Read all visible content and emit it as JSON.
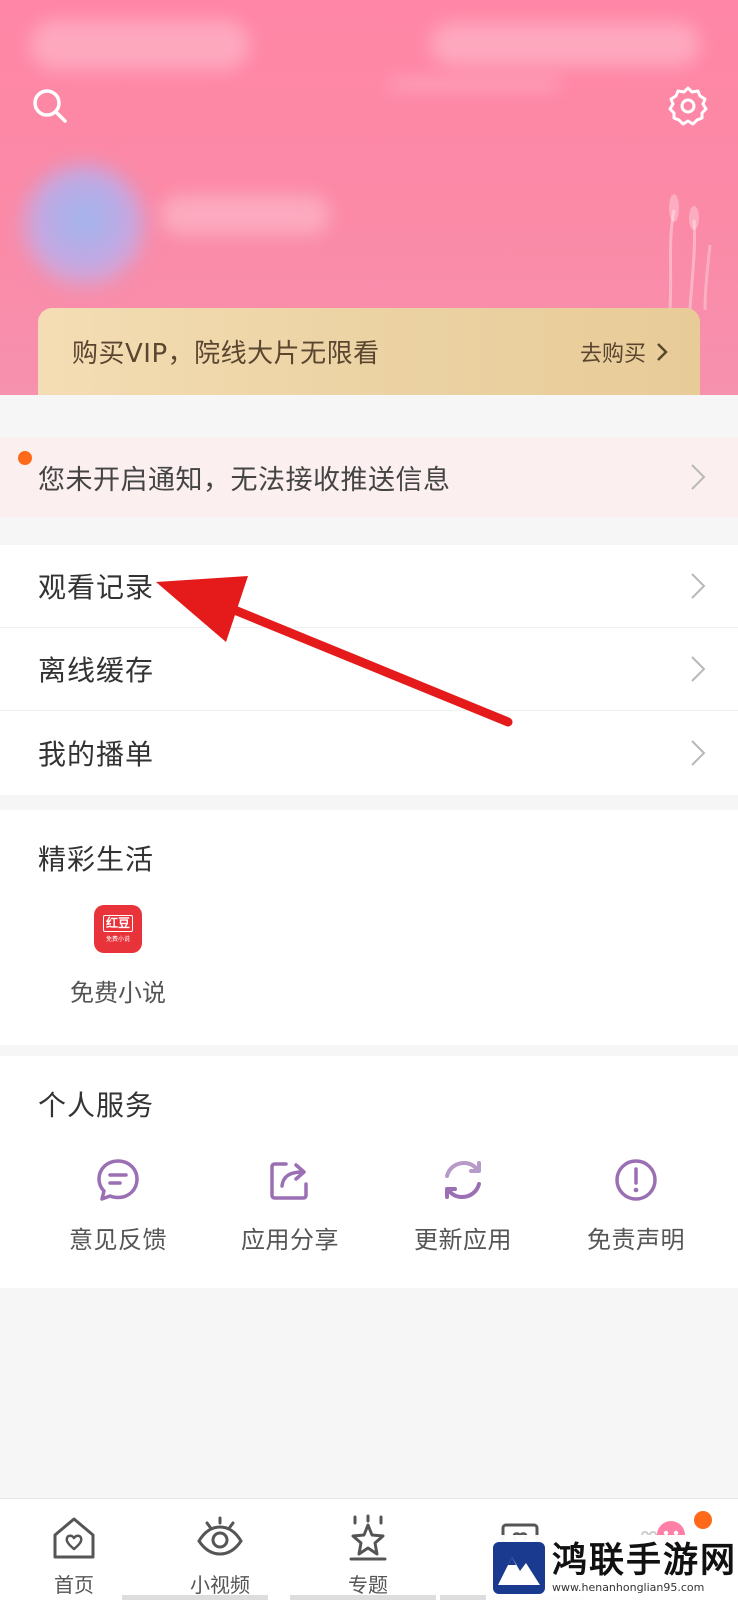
{
  "vip": {
    "text": "购买VIP，院线大片无限看",
    "buy_label": "去购买"
  },
  "notice": {
    "text": "您未开启通知，无法接收推送信息"
  },
  "menu": [
    {
      "label": "观看记录"
    },
    {
      "label": "离线缓存"
    },
    {
      "label": "我的播单"
    }
  ],
  "life": {
    "title": "精彩生活",
    "apps": [
      {
        "label": "免费小说",
        "icon": "hongdou-novel-app-icon",
        "icon_text": "红豆",
        "icon_subtext": "免费小说"
      }
    ]
  },
  "service": {
    "title": "个人服务",
    "items": [
      {
        "label": "意见反馈",
        "icon": "feedback-icon"
      },
      {
        "label": "应用分享",
        "icon": "share-icon"
      },
      {
        "label": "更新应用",
        "icon": "update-icon"
      },
      {
        "label": "免责声明",
        "icon": "disclaimer-icon"
      }
    ]
  },
  "bottom_nav": [
    {
      "label": "首页",
      "icon": "home-icon"
    },
    {
      "label": "小视频",
      "icon": "eye-icon"
    },
    {
      "label": "专题",
      "icon": "star-icon"
    },
    {
      "label": "",
      "icon": "tv-icon"
    },
    {
      "label": "",
      "icon": "mine-icon"
    }
  ],
  "watermark": {
    "title": "鸿联手游网",
    "url": "www.henanhonglian95.com"
  },
  "colors": {
    "header_pink": "#fb8aa7",
    "vip_gold": "#ecd3a4",
    "icon_purple": "#9b6fb3",
    "notice_dot": "#ff6a1a",
    "annotation_red": "#e51a1a"
  }
}
